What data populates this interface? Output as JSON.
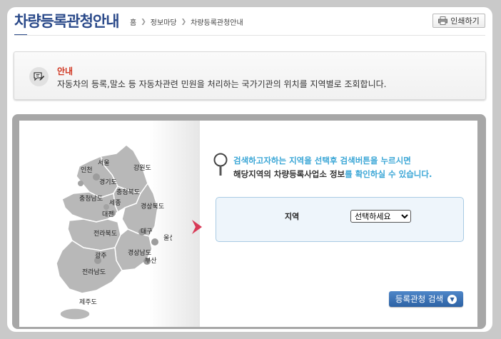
{
  "header": {
    "title": "차량등록관청안내",
    "breadcrumb": {
      "home": "홈",
      "section": "정보마당",
      "current": "차량등록관청안내"
    },
    "print_label": "인쇄하기"
  },
  "notice": {
    "title": "안내",
    "text": "자동차의 등록,말소 등 자동차관련 민원을 처리하는 국가기관의 위치를 지역별로 조회합니다."
  },
  "map": {
    "regions": {
      "seoul": "서울",
      "incheon": "인천",
      "gangwon": "강원도",
      "gyeonggi": "경기도",
      "chungbuk": "충청북도",
      "chungnam": "충청남도",
      "sejong": "세종",
      "daejeon": "대전",
      "gyeongbuk": "경상북도",
      "jeonbuk": "전라북도",
      "daegu": "대구",
      "ulsan": "울산",
      "gwangju": "광주",
      "gyeongnam": "경상남도",
      "busan": "부산",
      "jeonnam": "전라남도",
      "jeju": "제주도"
    }
  },
  "guide": {
    "line1": "검색하고자하는 지역을 선택후 검색버튼을 누르시면",
    "line2_strong": "해당지역의 차량등록사업소 정보",
    "line2_rest": "를 확인하실 수 있습니다."
  },
  "search": {
    "region_label": "지역",
    "region_selected": "선택하세요",
    "button_label": "등록관청 검색"
  },
  "colors": {
    "title": "#2b4a8a",
    "accent_blue": "#3aa6d6",
    "notice_title": "#d0341e",
    "arrow": "#d83a57",
    "button": "#3d74b8"
  }
}
